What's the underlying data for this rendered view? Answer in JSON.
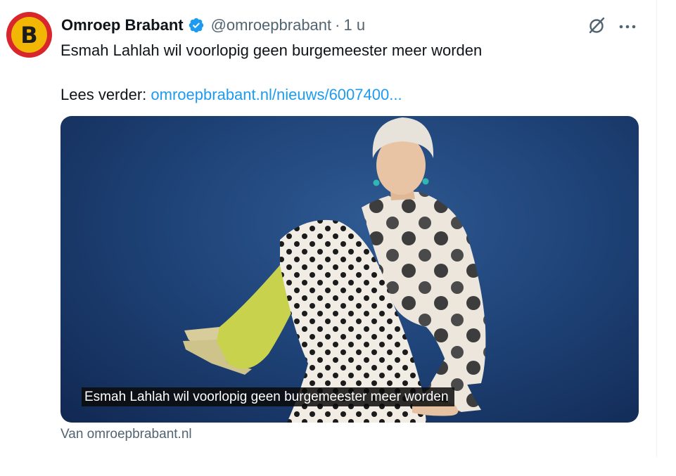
{
  "tweet": {
    "author_name": "Omroep Brabant",
    "handle": "@omroepbrabant",
    "separator": "·",
    "time": "1 u",
    "avatar_letter": "B",
    "verified_icon": "verified-badge-icon",
    "text": "Esmah Lahlah wil voorlopig geen burgemeester meer worden",
    "read_more_label": "Lees verder:",
    "link_text": "omroepbrabant.nl/nieuws/6007400..."
  },
  "media": {
    "caption": "Esmah Lahlah wil voorlopig geen burgemeester meer worden",
    "source": "Van omroepbrabant.nl"
  },
  "colors": {
    "accent": "#1d9bf0",
    "secondary_text": "#536471",
    "avatar_red": "#d9262d",
    "avatar_yellow": "#f2b705",
    "photo_background": "#1f4479"
  }
}
